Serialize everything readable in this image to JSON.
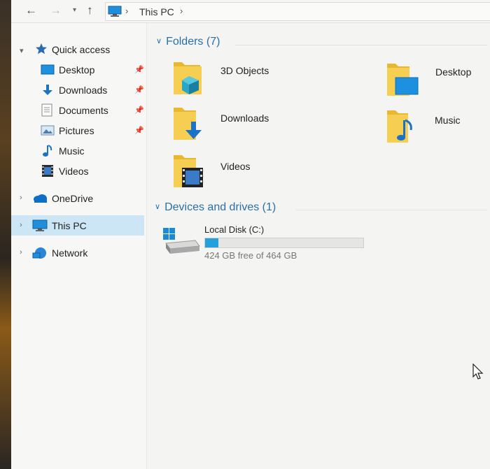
{
  "address_bar": {
    "back_icon": "arrow-left-icon",
    "forward_icon": "arrow-right-icon",
    "recent_icon": "chevron-down-icon",
    "up_icon": "arrow-up-icon",
    "location_icon": "this-pc-icon",
    "separator": "›",
    "path": "This PC"
  },
  "sidebar": {
    "quick_access": {
      "label": "Quick access",
      "icon": "star-icon",
      "items": [
        {
          "label": "Desktop",
          "icon": "desktop-icon",
          "pinned": true
        },
        {
          "label": "Downloads",
          "icon": "download-arrow-icon",
          "pinned": true
        },
        {
          "label": "Documents",
          "icon": "document-icon",
          "pinned": true
        },
        {
          "label": "Pictures",
          "icon": "picture-icon",
          "pinned": true
        },
        {
          "label": "Music",
          "icon": "music-note-icon",
          "pinned": false
        },
        {
          "label": "Videos",
          "icon": "film-icon",
          "pinned": false
        }
      ]
    },
    "onedrive": {
      "label": "OneDrive",
      "icon": "cloud-icon"
    },
    "this_pc": {
      "label": "This PC",
      "icon": "monitor-icon",
      "selected": true
    },
    "network": {
      "label": "Network",
      "icon": "network-icon"
    }
  },
  "content": {
    "folders_group": {
      "title": "Folders (7)",
      "items": [
        {
          "label": "3D Objects",
          "icon": "3d-objects-folder-icon"
        },
        {
          "label": "Desktop",
          "icon": "desktop-folder-icon"
        },
        {
          "label": "Downloads",
          "icon": "downloads-folder-icon"
        },
        {
          "label": "Music",
          "icon": "music-folder-icon"
        },
        {
          "label": "Videos",
          "icon": "videos-folder-icon"
        }
      ]
    },
    "devices_group": {
      "title": "Devices and drives (1)",
      "drives": [
        {
          "label": "Local Disk (C:)",
          "free_text": "424 GB free of 464 GB",
          "used_fraction": 0.086,
          "icon": "windows-drive-icon"
        }
      ]
    }
  },
  "colors": {
    "accent": "#2a6fa8",
    "selection": "#cde6f6",
    "drive_fill": "#26a0da",
    "folder_yellow": "#f4c542"
  }
}
